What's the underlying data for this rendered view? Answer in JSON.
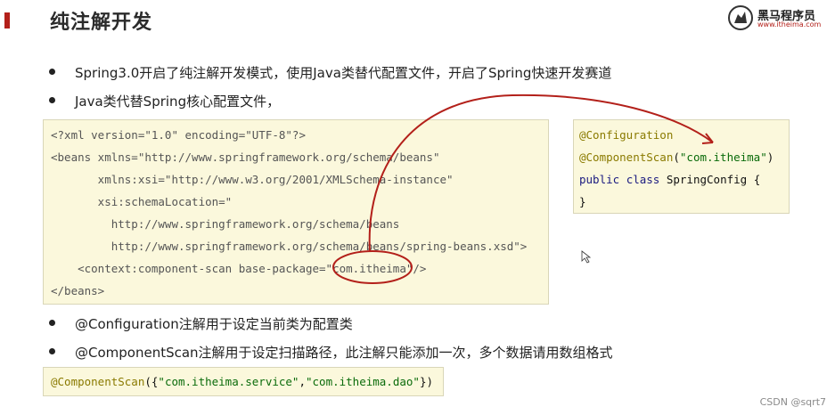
{
  "slide": {
    "title": "纯注解开发",
    "accent_color": "#b3201a"
  },
  "logo": {
    "name": "黑马程序员",
    "url": "www.itheima.com"
  },
  "bullets_top": [
    "Spring3.0开启了纯注解开发模式，使用Java类替代配置文件，开启了Spring快速开发赛道",
    "Java类代替Spring核心配置文件，"
  ],
  "xml_code": {
    "lines": [
      "<?xml version=\"1.0\" encoding=\"UTF-8\"?>",
      "<beans xmlns=\"http://www.springframework.org/schema/beans\"",
      "       xmlns:xsi=\"http://www.w3.org/2001/XMLSchema-instance\"",
      "       xsi:schemaLocation=\"",
      "         http://www.springframework.org/schema/beans",
      "         http://www.springframework.org/schema/beans/spring-beans.xsd\">",
      "    <context:component-scan base-package=\"com.itheima\"/>",
      "</beans>"
    ]
  },
  "java_code": {
    "line1": "@Configuration",
    "line2_ann": "@ComponentScan",
    "line2_open": "(",
    "line2_str": "\"com.itheima\"",
    "line2_close": ")",
    "line3_kw1": "public",
    "line3_kw2": "class",
    "line3_name": "SpringConfig {",
    "line4": "}"
  },
  "bullets_bottom": [
    "@Configuration注解用于设定当前类为配置类",
    "@ComponentScan注解用于设定扫描路径，此注解只能添加一次，多个数据请用数组格式"
  ],
  "scan_code": {
    "ann": "@ComponentScan",
    "open": "({",
    "str1": "\"com.itheima.service\"",
    "comma": ",",
    "str2": "\"com.itheima.dao\"",
    "close": "})"
  },
  "watermark": "CSDN @sqrt7",
  "colors": {
    "code_background": "#fbf8dc",
    "arrow": "#b3201a"
  }
}
